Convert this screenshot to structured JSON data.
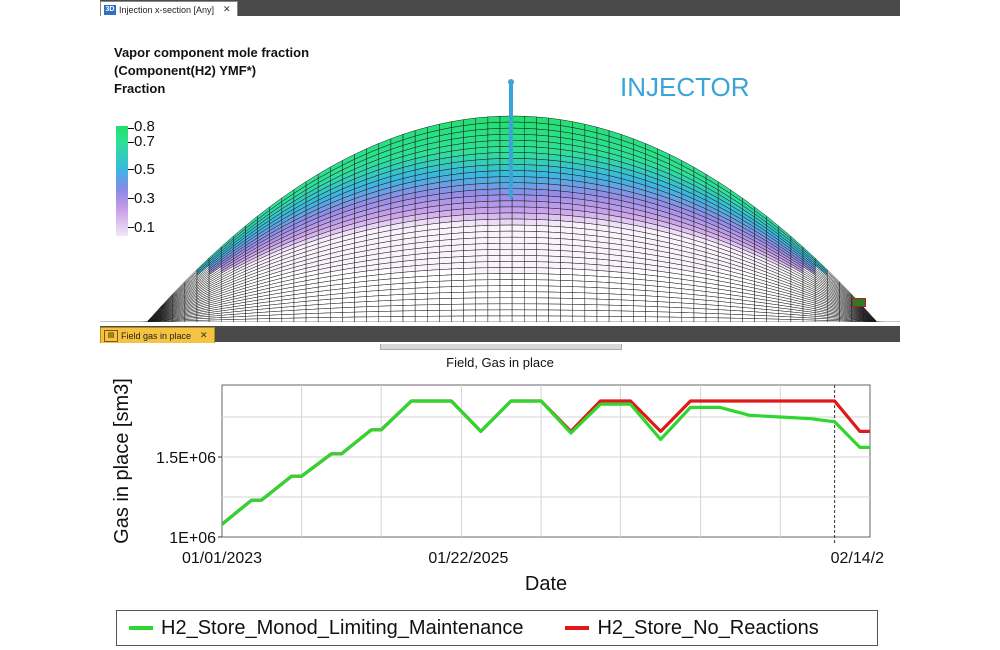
{
  "top_tab": {
    "icon": "3D",
    "label": "Injection x-section [Any]",
    "close": "✕"
  },
  "bottom_tab": {
    "label": "Field gas in place",
    "close": "✕"
  },
  "legend": {
    "title_lines": [
      "Vapor component mole fraction",
      "(Component(H2) YMF*)",
      "Fraction"
    ],
    "ticks": [
      "0.8",
      "0.7",
      "0.5",
      "0.3",
      "0.1"
    ]
  },
  "injector_label": "INJECTOR",
  "chart_data": {
    "type": "line",
    "title": "Field, Gas in place",
    "xlabel": "Date",
    "ylabel": "Gas in place [sm3]",
    "x_tick_labels": [
      "01/01/2023",
      "01/22/2025",
      "02/14/2"
    ],
    "y_tick_labels": [
      "1.5E+06",
      "1E+06"
    ],
    "ylim": [
      1000000,
      1950000
    ],
    "grid": true,
    "legend_position": "bottom",
    "colors": {
      "green": "#2fd62f",
      "red": "#e01818"
    },
    "x": [
      "2023-01-01",
      "2023-04-01",
      "2023-05-01",
      "2023-08-01",
      "2023-09-01",
      "2023-12-01",
      "2024-01-01",
      "2024-04-01",
      "2024-05-01",
      "2024-08-01",
      "2024-09-01",
      "2024-12-01",
      "2025-03-01",
      "2025-06-01",
      "2025-09-01",
      "2025-12-01",
      "2026-03-01",
      "2026-06-01",
      "2026-09-01",
      "2026-12-01",
      "2027-03-01",
      "2027-06-01",
      "2027-09-01",
      "2027-12-01",
      "2028-02-14",
      "2028-05-01",
      "2028-06-01"
    ],
    "series": [
      {
        "name": "H2_Store_Monod_Limiting_Maintenance",
        "values": [
          1080000,
          1230000,
          1230000,
          1380000,
          1380000,
          1520000,
          1520000,
          1670000,
          1670000,
          1850000,
          1850000,
          1850000,
          1660000,
          1850000,
          1850000,
          1650000,
          1830000,
          1830000,
          1610000,
          1810000,
          1810000,
          1760000,
          1750000,
          1740000,
          1720000,
          1560000,
          1560000
        ]
      },
      {
        "name": "H2_Store_No_Reactions",
        "values": [
          1080000,
          1230000,
          1230000,
          1380000,
          1380000,
          1520000,
          1520000,
          1670000,
          1670000,
          1850000,
          1850000,
          1850000,
          1660000,
          1850000,
          1850000,
          1660000,
          1850000,
          1850000,
          1660000,
          1850000,
          1850000,
          1850000,
          1850000,
          1850000,
          1850000,
          1660000,
          1660000
        ]
      }
    ],
    "marker_date": "2028-02-14"
  }
}
